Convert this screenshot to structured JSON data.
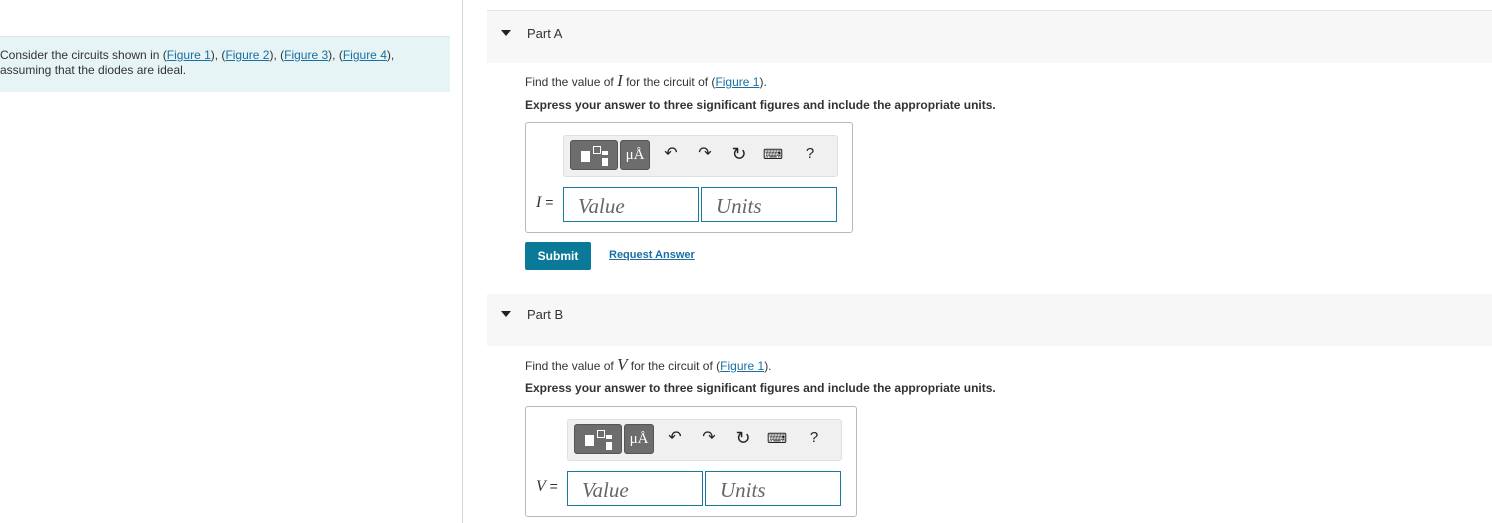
{
  "intro": {
    "prefix": "Consider the circuits shown in (",
    "fig1": "Figure 1",
    "sep1": "), (",
    "fig2": "Figure 2",
    "sep2": "), (",
    "fig3": "Figure 3",
    "sep3": "), (",
    "fig4": "Figure 4",
    "suffix": "),",
    "line2": "assuming that the diodes are ideal."
  },
  "parts": [
    {
      "title": "Part A",
      "question_prefix": "Find the value of ",
      "variable": "I",
      "question_mid": " for the circuit of (",
      "figure_link": "Figure 1",
      "question_suffix": ").",
      "instruction": "Express your answer to three significant figures and include the appropriate units.",
      "var_label": "I",
      "equals": "=",
      "value_placeholder": "Value",
      "units_placeholder": "Units",
      "submit_label": "Submit",
      "request_label": "Request Answer"
    },
    {
      "title": "Part B",
      "question_prefix": "Find the value of ",
      "variable": "V",
      "question_mid": " for the circuit of (",
      "figure_link": "Figure 1",
      "question_suffix": ").",
      "instruction": "Express your answer to three significant figures and include the appropriate units.",
      "var_label": "V",
      "equals": "=",
      "value_placeholder": "Value",
      "units_placeholder": "Units"
    }
  ],
  "toolbar": {
    "units_glyph": "μÅ",
    "undo_icon": "undo-icon",
    "redo_icon": "redo-icon",
    "reset_icon": "reset-icon",
    "keyboard_icon": "keyboard-icon",
    "help_label": "?"
  },
  "colors": {
    "submit_bg": "#0b7a99",
    "link": "#1a6fa3",
    "intro_bg": "#e6f4f5",
    "field_border": "#1a7a99"
  }
}
